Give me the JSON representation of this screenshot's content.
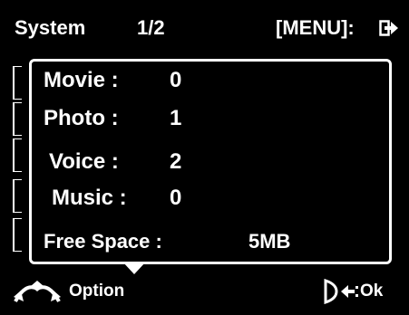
{
  "header": {
    "title": "System",
    "page": "1/2",
    "menu_label": "[MENU]:"
  },
  "stats": [
    {
      "label": "Movie :",
      "value": "0"
    },
    {
      "label": "Photo :",
      "value": "1"
    },
    {
      "label": "Voice :",
      "value": "2"
    },
    {
      "label": "Music :",
      "value": "0"
    },
    {
      "label": "Free Space :",
      "value": "5MB"
    }
  ],
  "footer": {
    "option_label": "Option",
    "ok_label": "Ok"
  },
  "icons": {
    "exit": "exit-icon",
    "navigate": "navigate-arrows-icon",
    "dial": "dial-icon",
    "back": "back-arrow-icon",
    "down": "down-triangle-icon"
  },
  "colors": {
    "background": "#000000",
    "foreground": "#ffffff"
  }
}
